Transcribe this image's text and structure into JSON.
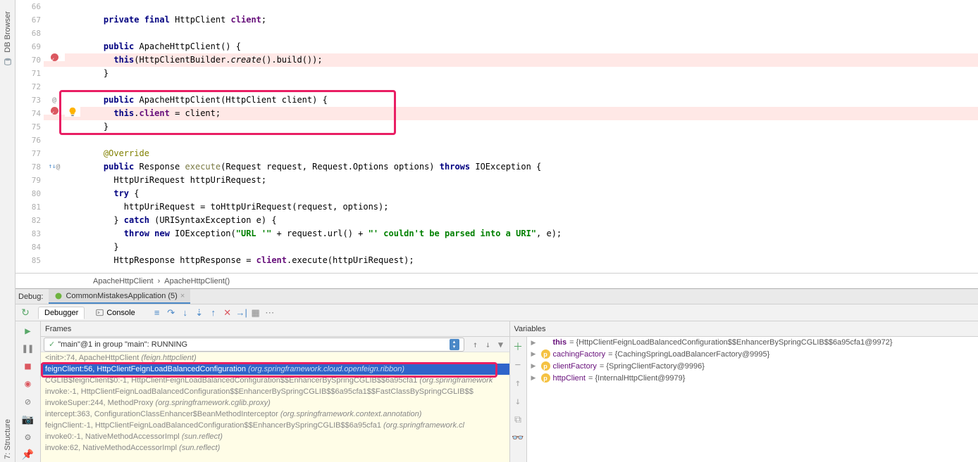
{
  "leftSidebar": {
    "dbBrowser": "DB Browser",
    "structure": "Structure",
    "structureNum": "7:"
  },
  "code": {
    "lines": [
      {
        "n": 66,
        "ind": 0,
        "segs": []
      },
      {
        "n": 67,
        "ind": 2,
        "segs": [
          {
            "c": "kw",
            "t": "private final "
          },
          {
            "t": "HttpClient "
          },
          {
            "c": "field",
            "t": "client"
          },
          {
            "t": ";"
          }
        ]
      },
      {
        "n": 68,
        "ind": 0,
        "segs": []
      },
      {
        "n": 69,
        "ind": 2,
        "segs": [
          {
            "c": "kw",
            "t": "public "
          },
          {
            "t": "ApacheHttpClient() {"
          }
        ]
      },
      {
        "n": 70,
        "ind": 3,
        "hl": true,
        "bp": true,
        "segs": [
          {
            "c": "kw",
            "t": "this"
          },
          {
            "t": "(HttpClientBuilder."
          },
          {
            "c": "static-m",
            "t": "create"
          },
          {
            "t": "().build());"
          }
        ]
      },
      {
        "n": 71,
        "ind": 2,
        "segs": [
          {
            "t": "}"
          }
        ]
      },
      {
        "n": 72,
        "ind": 0,
        "segs": []
      },
      {
        "n": 73,
        "ind": 2,
        "ov": "@",
        "segs": [
          {
            "c": "kw",
            "t": "public "
          },
          {
            "t": "ApacheHttpClient(HttpClient client) {"
          }
        ]
      },
      {
        "n": 74,
        "ind": 3,
        "hl": true,
        "bp": true,
        "bulb": true,
        "segs": [
          {
            "c": "kw",
            "t": "this"
          },
          {
            "t": "."
          },
          {
            "c": "field",
            "t": "client"
          },
          {
            "t": " = client;"
          }
        ]
      },
      {
        "n": 75,
        "ind": 2,
        "segs": [
          {
            "t": "}"
          }
        ]
      },
      {
        "n": 76,
        "ind": 0,
        "segs": []
      },
      {
        "n": 77,
        "ind": 2,
        "segs": [
          {
            "c": "ann",
            "t": "@Override"
          }
        ]
      },
      {
        "n": 78,
        "ind": 2,
        "ov": "↑↓ @",
        "segs": [
          {
            "c": "kw",
            "t": "public "
          },
          {
            "t": "Response "
          },
          {
            "c": "method",
            "t": "execute"
          },
          {
            "t": "(Request request, Request.Options options) "
          },
          {
            "c": "kw",
            "t": "throws "
          },
          {
            "t": "IOException {"
          }
        ]
      },
      {
        "n": 79,
        "ind": 3,
        "segs": [
          {
            "t": "HttpUriRequest httpUriRequest;"
          }
        ]
      },
      {
        "n": 80,
        "ind": 3,
        "segs": [
          {
            "c": "kw",
            "t": "try "
          },
          {
            "t": "{"
          }
        ]
      },
      {
        "n": 81,
        "ind": 4,
        "segs": [
          {
            "t": "httpUriRequest = toHttpUriRequest(request, options);"
          }
        ]
      },
      {
        "n": 82,
        "ind": 3,
        "segs": [
          {
            "t": "} "
          },
          {
            "c": "kw",
            "t": "catch "
          },
          {
            "t": "(URISyntaxException e) {"
          }
        ]
      },
      {
        "n": 83,
        "ind": 4,
        "segs": [
          {
            "c": "kw",
            "t": "throw new "
          },
          {
            "t": "IOException("
          },
          {
            "c": "str",
            "t": "\"URL '\""
          },
          {
            "t": " + request.url() + "
          },
          {
            "c": "str",
            "t": "\"' couldn't be parsed into a URI\""
          },
          {
            "t": ", e);"
          }
        ]
      },
      {
        "n": 84,
        "ind": 3,
        "segs": [
          {
            "t": "}"
          }
        ]
      },
      {
        "n": 85,
        "ind": 3,
        "segs": [
          {
            "t": "HttpResponse httpResponse = "
          },
          {
            "c": "field",
            "t": "client"
          },
          {
            "t": ".execute(httpUriRequest);"
          }
        ]
      }
    ]
  },
  "breadcrumb": {
    "a": "ApacheHttpClient",
    "b": "ApacheHttpClient()"
  },
  "debug": {
    "label": "Debug:",
    "runConfig": "CommonMistakesApplication (5)",
    "tabDebugger": "Debugger",
    "tabConsole": "Console",
    "frames": {
      "header": "Frames",
      "thread": "\"main\"@1 in group \"main\": RUNNING",
      "items": [
        {
          "text": "<init>:74, ApacheHttpClient",
          "pkg": "(feign.httpclient)",
          "dim": true
        },
        {
          "text": "feignClient:56, HttpClientFeignLoadBalancedConfiguration",
          "pkg": "(org.springframework.cloud.openfeign.ribbon)",
          "sel": true
        },
        {
          "text": "CGLIB$feignClient$0:-1, HttpClientFeignLoadBalancedConfiguration$$EnhancerBySpringCGLIB$$6a95cfa1",
          "pkg": "(org.springframework",
          "dim": true
        },
        {
          "text": "invoke:-1, HttpClientFeignLoadBalancedConfiguration$$EnhancerBySpringCGLIB$$6a95cfa1$$FastClassBySpringCGLIB$$",
          "pkg": "",
          "dim": true
        },
        {
          "text": "invokeSuper:244, MethodProxy",
          "pkg": "(org.springframework.cglib.proxy)",
          "dim": true
        },
        {
          "text": "intercept:363, ConfigurationClassEnhancer$BeanMethodInterceptor",
          "pkg": "(org.springframework.context.annotation)",
          "dim": true
        },
        {
          "text": "feignClient:-1, HttpClientFeignLoadBalancedConfiguration$$EnhancerBySpringCGLIB$$6a95cfa1",
          "pkg": "(org.springframework.cl",
          "dim": true
        },
        {
          "text": "invoke0:-1, NativeMethodAccessorImpl",
          "pkg": "(sun.reflect)",
          "dim": true
        },
        {
          "text": "invoke:62, NativeMethodAccessorImpl",
          "pkg": "(sun.reflect)",
          "dim": true
        }
      ]
    },
    "vars": {
      "header": "Variables",
      "items": [
        {
          "tri": "▶",
          "badge": "",
          "name": "this",
          "val": " = {HttpClientFeignLoadBalancedConfiguration$$EnhancerBySpringCGLIB$$6a95cfa1@9972}",
          "nbold": true
        },
        {
          "tri": "▶",
          "badge": "p",
          "name": "cachingFactory",
          "val": " = {CachingSpringLoadBalancerFactory@9995}"
        },
        {
          "tri": "▶",
          "badge": "p",
          "name": "clientFactory",
          "val": " = {SpringClientFactory@9996}"
        },
        {
          "tri": "▶",
          "badge": "p",
          "name": "httpClient",
          "val": " = {InternalHttpClient@9979}"
        }
      ]
    }
  }
}
